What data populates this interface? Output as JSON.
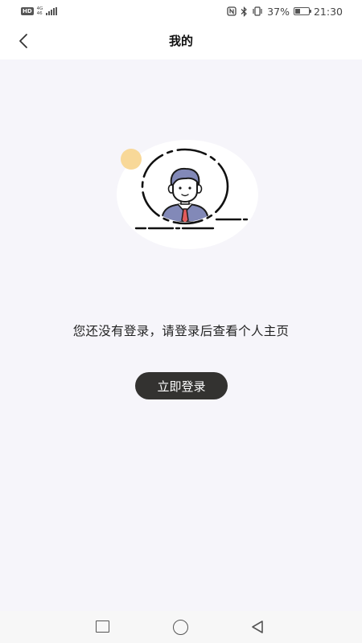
{
  "status_bar": {
    "hd_badge": "HD",
    "network_top": "4G",
    "network_bottom": "46",
    "battery_percent": "37%",
    "battery_level": 0.37,
    "time": "21:30",
    "icons": [
      "hd-icon",
      "signal-icon",
      "nfc-icon",
      "bluetooth-icon",
      "vibrate-icon",
      "battery-icon"
    ]
  },
  "header": {
    "back_icon": "chevron-left-icon",
    "title": "我的"
  },
  "main": {
    "illustration": "user-avatar-illustration",
    "prompt": "您还没有登录，请登录后查看个人主页",
    "login_button": "立即登录"
  },
  "system_nav": {
    "icons": [
      "recent-apps-icon",
      "home-icon",
      "back-icon"
    ]
  },
  "colors": {
    "background": "#f6f5fa",
    "button_bg": "#333230",
    "button_text": "#ffffff",
    "accent_dot": "#f8d898",
    "avatar_shirt": "#8289b8",
    "avatar_tie": "#e05b5b"
  }
}
